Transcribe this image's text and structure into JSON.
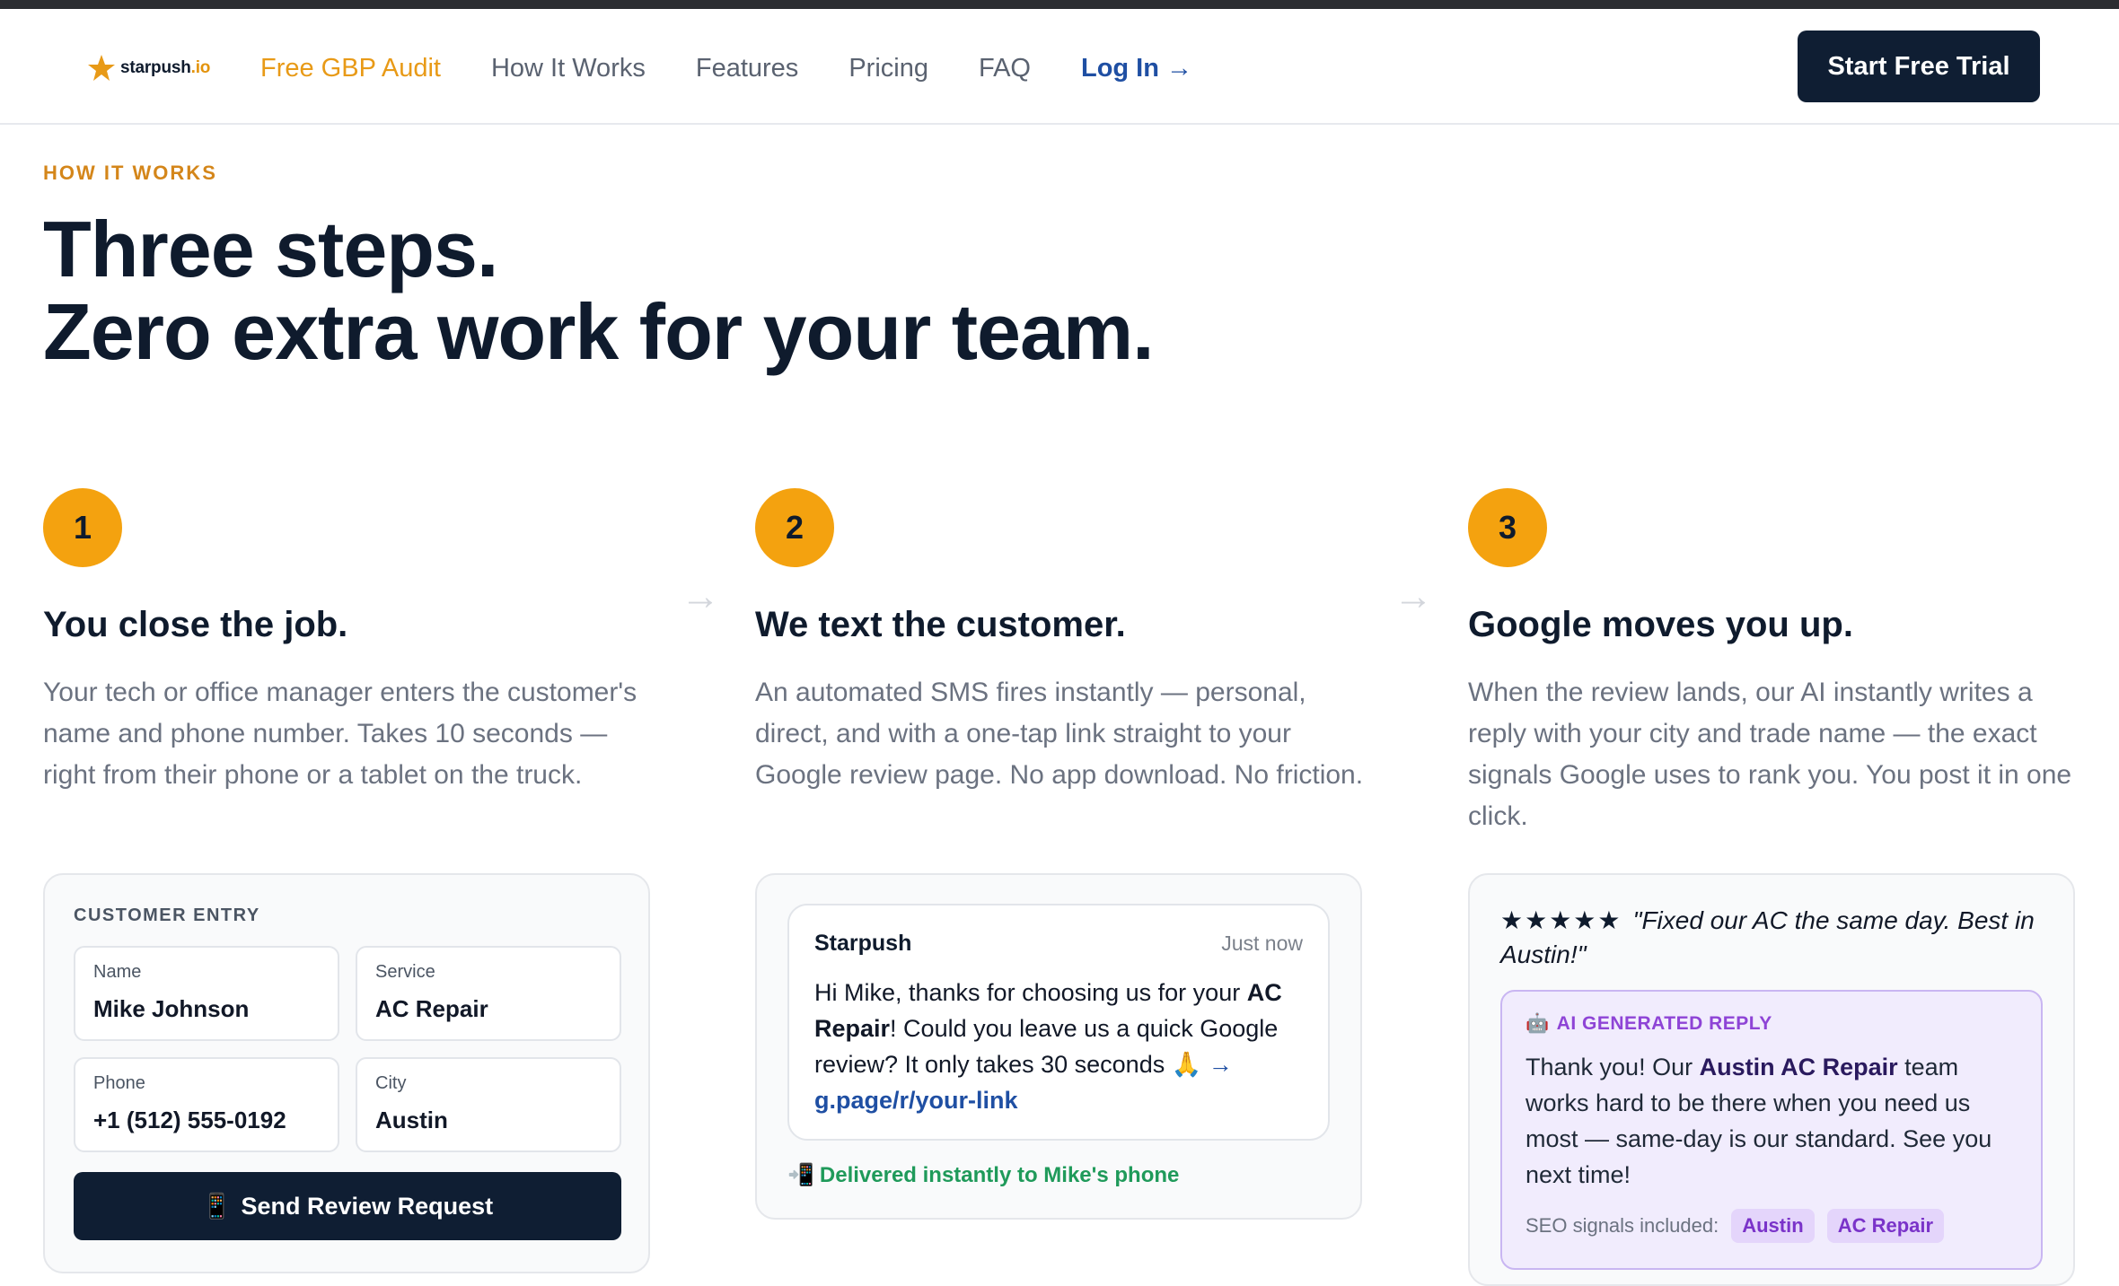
{
  "nav": {
    "logo_name": "starpush",
    "logo_tld": ".io",
    "links": [
      "Free GBP Audit",
      "How It Works",
      "Features",
      "Pricing",
      "FAQ",
      "Log In →"
    ],
    "cta": "Start Free Trial"
  },
  "hero": {
    "eyebrow": "HOW IT WORKS",
    "headline_line1": "Three steps.",
    "headline_line2": "Zero extra work for your team."
  },
  "steps": [
    {
      "number": "1",
      "title": "You close the job.",
      "desc": "Your tech or office manager enters the customer's name and phone number. Takes 10 seconds — right from their phone or a tablet on the truck."
    },
    {
      "number": "2",
      "title": "We text the customer.",
      "desc": "An automated SMS fires instantly — personal, direct, and with a one-tap link straight to your Google review page. No app download. No friction."
    },
    {
      "number": "3",
      "title": "Google moves you up.",
      "desc": "When the review lands, our AI instantly writes a reply with your city and trade name — the exact signals Google uses to rank you. You post it in one click."
    }
  ],
  "arrows": [
    "→",
    "→"
  ],
  "entry_card": {
    "label": "CUSTOMER ENTRY",
    "fields": [
      {
        "label": "Name",
        "value": "Mike Johnson"
      },
      {
        "label": "Service",
        "value": "AC Repair"
      },
      {
        "label": "Phone",
        "value": "+1 (512) 555-0192"
      },
      {
        "label": "City",
        "value": "Austin"
      }
    ],
    "button_icon": "📱",
    "button_label": "Send Review Request"
  },
  "sms_card": {
    "sender": "Starpush",
    "time": "Just now",
    "msg_part1": "Hi Mike, thanks for choosing us for your ",
    "msg_bold": "AC Repair",
    "msg_part2": "! Could you leave us a quick Google review? It only takes 30 seconds 🙏 ",
    "link": "→ g.page/r/your-link",
    "delivered_icon": "📲",
    "delivered": "Delivered instantly to Mike's phone"
  },
  "review_card": {
    "stars": "★★★★★",
    "quote": "\"Fixed our AC the same day. Best in Austin!\"",
    "ai_icon": "🤖",
    "ai_label": "AI GENERATED REPLY",
    "reply_part1": "Thank you! Our ",
    "reply_bold": "Austin AC Repair",
    "reply_part2": " team works hard to be there when you need us most — same-day is our standard. See you next time!",
    "seo_label": "SEO signals included:",
    "tags": [
      "Austin",
      "AC Repair"
    ]
  },
  "colors": {
    "accent_orange": "#f4a20f",
    "navy": "#0f1e33",
    "link_blue": "#1f4fa3",
    "green": "#1f9a5a",
    "purple": "#8e44d6"
  }
}
